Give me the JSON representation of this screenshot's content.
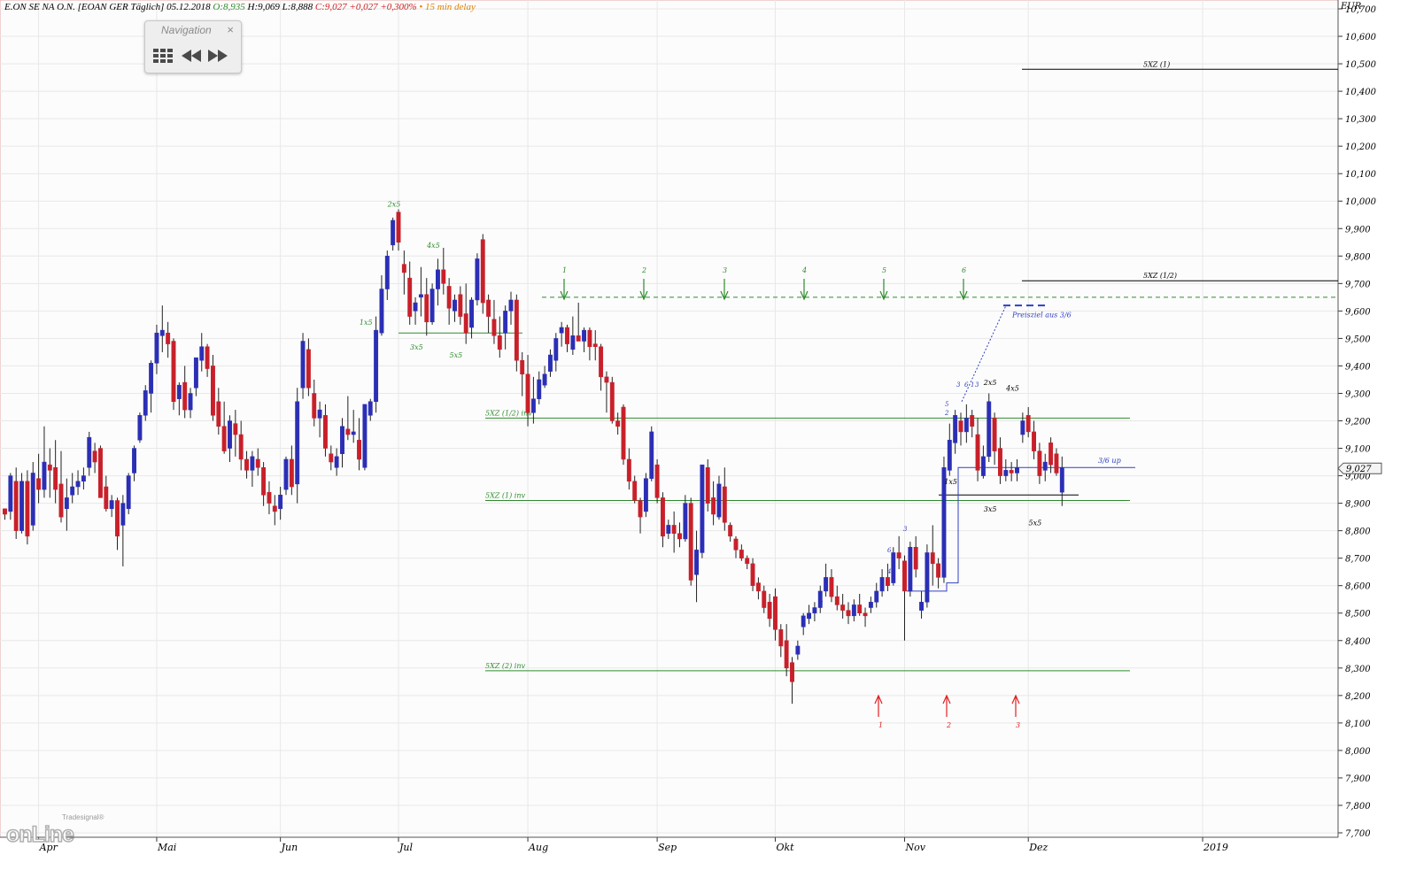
{
  "header": {
    "title": "E.ON SE NA O.N. [EOAN GER Täglich] 05.12.2018",
    "open": "O:8,935",
    "hl": "H:9,069 L:8,888",
    "close": "C:9,027 +0,027 +0,300%",
    "delay": "• 15 min delay"
  },
  "navigation": {
    "title": "Navigation",
    "close": "×"
  },
  "logo": {
    "brand": "Tradesignal®",
    "text": "onLine"
  },
  "colors": {
    "up": "#2b2fb5",
    "down": "#c8202a",
    "green": "#2e8b2e",
    "red": "#e02020",
    "blue": "#3040c0"
  },
  "chart_data": {
    "type": "candlestick",
    "currency": "EUR",
    "ylim": [
      7.7,
      10.7
    ],
    "y_ticks": [
      "7,700",
      "7,800",
      "7,900",
      "8,000",
      "8,100",
      "8,200",
      "8,300",
      "8,400",
      "8,500",
      "8,600",
      "8,700",
      "8,800",
      "8,900",
      "9,000",
      "9,100",
      "9,200",
      "9,300",
      "9,400",
      "9,500",
      "9,600",
      "9,700",
      "9,800",
      "9,900",
      "10,000",
      "10,100",
      "10,200",
      "10,300",
      "10,400",
      "10,500",
      "10,600",
      "10,700"
    ],
    "x_labels": [
      {
        "label": "Apr",
        "bar": 6
      },
      {
        "label": "Mai",
        "bar": 27
      },
      {
        "label": "Jun",
        "bar": 49
      },
      {
        "label": "Jul",
        "bar": 70
      },
      {
        "label": "Aug",
        "bar": 93
      },
      {
        "label": "Sep",
        "bar": 116
      },
      {
        "label": "Okt",
        "bar": 137
      },
      {
        "label": "Nov",
        "bar": 160
      },
      {
        "label": "Dez",
        "bar": 182
      },
      {
        "label": "2019",
        "bar": 213
      }
    ],
    "last_price_label": "9,027",
    "candles": [
      [
        8.88,
        8.88,
        8.84,
        8.86
      ],
      [
        8.87,
        9.01,
        8.84,
        9.0
      ],
      [
        8.98,
        9.03,
        8.77,
        8.8
      ],
      [
        8.8,
        9.01,
        8.79,
        8.98
      ],
      [
        8.98,
        9.02,
        8.75,
        8.78
      ],
      [
        8.82,
        9.05,
        8.8,
        9.01
      ],
      [
        8.99,
        9.08,
        8.9,
        8.95
      ],
      [
        8.95,
        9.18,
        8.92,
        9.05
      ],
      [
        9.04,
        9.1,
        8.92,
        9.02
      ],
      [
        9.03,
        9.13,
        8.9,
        8.95
      ],
      [
        8.97,
        9.09,
        8.83,
        8.85
      ],
      [
        8.88,
        8.99,
        8.8,
        8.92
      ],
      [
        8.93,
        9.01,
        8.9,
        8.96
      ],
      [
        8.96,
        9.02,
        8.93,
        8.98
      ],
      [
        8.98,
        9.03,
        8.95,
        9.0
      ],
      [
        9.03,
        9.16,
        9.0,
        9.14
      ],
      [
        9.09,
        9.12,
        9.01,
        9.05
      ],
      [
        9.1,
        9.11,
        8.92,
        8.92
      ],
      [
        8.96,
        9.0,
        8.87,
        8.88
      ],
      [
        8.88,
        8.93,
        8.85,
        8.91
      ],
      [
        8.91,
        8.92,
        8.73,
        8.78
      ],
      [
        8.82,
        8.93,
        8.67,
        8.9
      ],
      [
        8.88,
        9.01,
        8.86,
        9.0
      ],
      [
        9.01,
        9.11,
        8.98,
        9.1
      ],
      [
        9.13,
        9.23,
        9.12,
        9.22
      ],
      [
        9.22,
        9.33,
        9.2,
        9.31
      ],
      [
        9.3,
        9.42,
        9.23,
        9.41
      ],
      [
        9.41,
        9.55,
        9.37,
        9.52
      ],
      [
        9.51,
        9.62,
        9.45,
        9.53
      ],
      [
        9.52,
        9.56,
        9.43,
        9.48
      ],
      [
        9.49,
        9.5,
        9.24,
        9.27
      ],
      [
        9.28,
        9.34,
        9.22,
        9.33
      ],
      [
        9.34,
        9.4,
        9.21,
        9.24
      ],
      [
        9.24,
        9.32,
        9.21,
        9.3
      ],
      [
        9.32,
        9.43,
        9.29,
        9.43
      ],
      [
        9.42,
        9.52,
        9.38,
        9.47
      ],
      [
        9.47,
        9.48,
        9.36,
        9.39
      ],
      [
        9.4,
        9.44,
        9.2,
        9.22
      ],
      [
        9.27,
        9.32,
        9.15,
        9.18
      ],
      [
        9.18,
        9.27,
        9.08,
        9.09
      ],
      [
        9.1,
        9.22,
        9.05,
        9.2
      ],
      [
        9.19,
        9.24,
        9.07,
        9.15
      ],
      [
        9.15,
        9.2,
        9.02,
        9.06
      ],
      [
        9.06,
        9.09,
        8.99,
        9.02
      ],
      [
        9.02,
        9.09,
        8.96,
        9.07
      ],
      [
        9.06,
        9.1,
        9.0,
        9.03
      ],
      [
        9.03,
        9.05,
        8.89,
        8.93
      ],
      [
        8.94,
        8.98,
        8.86,
        8.9
      ],
      [
        8.89,
        8.93,
        8.82,
        8.87
      ],
      [
        8.88,
        8.96,
        8.84,
        8.93
      ],
      [
        8.95,
        9.07,
        8.93,
        9.06
      ],
      [
        9.06,
        9.11,
        8.93,
        8.96
      ],
      [
        8.97,
        9.32,
        8.9,
        9.27
      ],
      [
        9.32,
        9.52,
        9.28,
        9.49
      ],
      [
        9.46,
        9.5,
        9.29,
        9.32
      ],
      [
        9.3,
        9.35,
        9.18,
        9.21
      ],
      [
        9.21,
        9.27,
        9.14,
        9.24
      ],
      [
        9.22,
        9.26,
        9.07,
        9.1
      ],
      [
        9.08,
        9.11,
        9.02,
        9.05
      ],
      [
        9.03,
        9.1,
        9.0,
        9.07
      ],
      [
        9.08,
        9.21,
        9.03,
        9.18
      ],
      [
        9.17,
        9.29,
        9.13,
        9.15
      ],
      [
        9.15,
        9.24,
        9.12,
        9.16
      ],
      [
        9.13,
        9.21,
        9.02,
        9.06
      ],
      [
        9.03,
        9.26,
        9.02,
        9.26
      ],
      [
        9.22,
        9.28,
        9.2,
        9.27
      ],
      [
        9.27,
        9.58,
        9.23,
        9.53
      ],
      [
        9.52,
        9.73,
        9.51,
        9.68
      ],
      [
        9.68,
        9.82,
        9.64,
        9.8
      ],
      [
        9.84,
        9.94,
        9.82,
        9.93
      ],
      [
        9.96,
        9.97,
        9.82,
        9.85
      ],
      [
        9.77,
        9.82,
        9.66,
        9.74
      ],
      [
        9.72,
        9.78,
        9.55,
        9.58
      ],
      [
        9.6,
        9.65,
        9.55,
        9.63
      ],
      [
        9.65,
        9.76,
        9.58,
        9.66
      ],
      [
        9.66,
        9.72,
        9.51,
        9.56
      ],
      [
        9.56,
        9.7,
        9.55,
        9.68
      ],
      [
        9.68,
        9.79,
        9.62,
        9.75
      ],
      [
        9.75,
        9.83,
        9.66,
        9.7
      ],
      [
        9.69,
        9.72,
        9.55,
        9.61
      ],
      [
        9.6,
        9.66,
        9.56,
        9.64
      ],
      [
        9.66,
        9.69,
        9.55,
        9.58
      ],
      [
        9.59,
        9.7,
        9.48,
        9.52
      ],
      [
        9.54,
        9.65,
        9.5,
        9.64
      ],
      [
        9.64,
        9.81,
        9.62,
        9.79
      ],
      [
        9.86,
        9.88,
        9.59,
        9.63
      ],
      [
        9.64,
        9.66,
        9.52,
        9.58
      ],
      [
        9.57,
        9.64,
        9.48,
        9.51
      ],
      [
        9.51,
        9.58,
        9.43,
        9.46
      ],
      [
        9.52,
        9.62,
        9.46,
        9.6
      ],
      [
        9.6,
        9.67,
        9.55,
        9.64
      ],
      [
        9.64,
        9.66,
        9.38,
        9.42
      ],
      [
        9.42,
        9.45,
        9.29,
        9.37
      ],
      [
        9.37,
        9.44,
        9.18,
        9.23
      ],
      [
        9.23,
        9.36,
        9.19,
        9.28
      ],
      [
        9.28,
        9.38,
        9.26,
        9.35
      ],
      [
        9.33,
        9.4,
        9.32,
        9.37
      ],
      [
        9.38,
        9.46,
        9.36,
        9.44
      ],
      [
        9.42,
        9.52,
        9.38,
        9.5
      ],
      [
        9.52,
        9.56,
        9.47,
        9.54
      ],
      [
        9.54,
        9.55,
        9.45,
        9.48
      ],
      [
        9.46,
        9.58,
        9.44,
        9.51
      ],
      [
        9.51,
        9.63,
        9.49,
        9.49
      ],
      [
        9.49,
        9.54,
        9.45,
        9.53
      ],
      [
        9.53,
        9.54,
        9.42,
        9.47
      ],
      [
        9.48,
        9.53,
        9.42,
        9.47
      ],
      [
        9.47,
        9.48,
        9.31,
        9.36
      ],
      [
        9.36,
        9.38,
        9.23,
        9.34
      ],
      [
        9.34,
        9.36,
        9.19,
        9.2
      ],
      [
        9.2,
        9.23,
        9.15,
        9.18
      ],
      [
        9.25,
        9.26,
        9.04,
        9.06
      ],
      [
        9.06,
        9.1,
        8.95,
        8.98
      ],
      [
        8.98,
        9.0,
        8.9,
        8.91
      ],
      [
        8.91,
        8.92,
        8.79,
        8.85
      ],
      [
        8.87,
        9.01,
        8.85,
        8.99
      ],
      [
        8.99,
        9.18,
        8.98,
        9.16
      ],
      [
        9.04,
        9.06,
        8.9,
        8.92
      ],
      [
        8.92,
        8.94,
        8.74,
        8.78
      ],
      [
        8.79,
        8.84,
        8.77,
        8.82
      ],
      [
        8.82,
        8.87,
        8.72,
        8.79
      ],
      [
        8.79,
        8.83,
        8.74,
        8.77
      ],
      [
        8.77,
        8.93,
        8.76,
        8.9
      ],
      [
        8.9,
        8.92,
        8.6,
        8.62
      ],
      [
        8.64,
        8.8,
        8.54,
        8.73
      ],
      [
        8.72,
        9.01,
        8.7,
        9.04
      ],
      [
        9.03,
        9.06,
        8.87,
        8.9
      ],
      [
        8.92,
        8.98,
        8.82,
        8.86
      ],
      [
        8.85,
        9.0,
        8.84,
        8.97
      ],
      [
        8.96,
        9.03,
        8.8,
        8.83
      ],
      [
        8.82,
        8.83,
        8.76,
        8.78
      ],
      [
        8.77,
        8.78,
        8.7,
        8.73
      ],
      [
        8.73,
        8.75,
        8.69,
        8.7
      ],
      [
        8.7,
        8.71,
        8.66,
        8.68
      ],
      [
        8.68,
        8.7,
        8.58,
        8.6
      ],
      [
        8.61,
        8.63,
        8.55,
        8.58
      ],
      [
        8.58,
        8.6,
        8.5,
        8.52
      ],
      [
        8.54,
        8.57,
        8.45,
        8.48
      ],
      [
        8.56,
        8.59,
        8.4,
        8.44
      ],
      [
        8.44,
        8.46,
        8.34,
        8.38
      ],
      [
        8.4,
        8.46,
        8.27,
        8.3
      ],
      [
        8.32,
        8.34,
        8.17,
        8.25
      ],
      [
        8.35,
        8.4,
        8.33,
        8.38
      ],
      [
        8.45,
        8.5,
        8.42,
        8.49
      ],
      [
        8.48,
        8.53,
        8.46,
        8.5
      ],
      [
        8.5,
        8.54,
        8.47,
        8.52
      ],
      [
        8.52,
        8.6,
        8.5,
        8.58
      ],
      [
        8.58,
        8.68,
        8.56,
        8.63
      ],
      [
        8.63,
        8.66,
        8.54,
        8.56
      ],
      [
        8.56,
        8.6,
        8.51,
        8.53
      ],
      [
        8.53,
        8.57,
        8.48,
        8.51
      ],
      [
        8.51,
        8.54,
        8.46,
        8.49
      ],
      [
        8.49,
        8.55,
        8.47,
        8.53
      ],
      [
        8.53,
        8.57,
        8.49,
        8.5
      ],
      [
        8.5,
        8.52,
        8.45,
        8.49
      ],
      [
        8.52,
        8.56,
        8.5,
        8.54
      ],
      [
        8.54,
        8.61,
        8.52,
        8.58
      ],
      [
        8.58,
        8.66,
        8.56,
        8.63
      ],
      [
        8.63,
        8.68,
        8.58,
        8.6
      ],
      [
        8.61,
        8.74,
        8.6,
        8.72
      ],
      [
        8.72,
        8.78,
        8.66,
        8.7
      ],
      [
        8.69,
        8.71,
        8.4,
        8.58
      ],
      [
        8.58,
        8.76,
        8.56,
        8.74
      ],
      [
        8.74,
        8.78,
        8.63,
        8.66
      ],
      [
        8.51,
        8.58,
        8.48,
        8.54
      ],
      [
        8.54,
        8.75,
        8.52,
        8.72
      ],
      [
        8.72,
        8.82,
        8.6,
        8.68
      ],
      [
        8.68,
        8.7,
        8.59,
        8.63
      ],
      [
        8.63,
        9.07,
        8.61,
        9.03
      ],
      [
        9.02,
        9.19,
        9.0,
        9.13
      ],
      [
        9.12,
        9.24,
        9.08,
        9.22
      ],
      [
        9.2,
        9.23,
        9.11,
        9.16
      ],
      [
        9.16,
        9.26,
        9.12,
        9.21
      ],
      [
        9.22,
        9.24,
        9.14,
        9.18
      ],
      [
        9.15,
        9.21,
        8.98,
        9.02
      ],
      [
        9.0,
        9.11,
        8.99,
        9.07
      ],
      [
        9.07,
        9.3,
        9.05,
        9.27
      ],
      [
        9.21,
        9.23,
        9.04,
        9.09
      ],
      [
        9.1,
        9.14,
        8.97,
        9.0
      ],
      [
        9.0,
        9.06,
        8.98,
        9.02
      ],
      [
        9.02,
        9.05,
        8.98,
        9.01
      ],
      [
        9.01,
        9.06,
        8.98,
        9.03
      ],
      [
        9.15,
        9.23,
        9.12,
        9.2
      ],
      [
        9.22,
        9.25,
        9.14,
        9.16
      ],
      [
        9.16,
        9.2,
        9.06,
        9.09
      ],
      [
        9.09,
        9.12,
        8.97,
        9.0
      ],
      [
        9.02,
        9.08,
        8.98,
        9.05
      ],
      [
        9.12,
        9.14,
        9.01,
        9.04
      ],
      [
        9.08,
        9.1,
        9.0,
        9.01
      ],
      [
        8.94,
        9.07,
        8.89,
        9.03
      ]
    ],
    "horizontal_lines": [
      {
        "label": "5XZ (1)",
        "y": 10.48,
        "color": "#000000"
      },
      {
        "label": "5XZ (1/2)",
        "y": 9.71,
        "color": "#000000"
      },
      {
        "label": "5XZ (1/2) inv",
        "y": 9.21,
        "color": "#2e8b2e"
      },
      {
        "label": "5XZ (1) inv",
        "y": 8.91,
        "color": "#2e8b2e"
      },
      {
        "label": "5XZ (2) inv",
        "y": 8.29,
        "color": "#2e8b2e"
      },
      {
        "label": "",
        "y": 9.65,
        "color": "#2e8b2e",
        "dashed": true
      }
    ],
    "annotations": [
      {
        "text": "Preisziel aus 3/6",
        "y": 9.59,
        "color": "#3040c0"
      },
      {
        "text": "3/6 up",
        "y": 9.04,
        "color": "#3040c0"
      },
      {
        "text": "2x5",
        "bar": 69,
        "y": 9.98,
        "color": "#2e8b2e"
      },
      {
        "text": "4x5",
        "bar": 76,
        "y": 9.83,
        "color": "#2e8b2e"
      },
      {
        "text": "1x5",
        "bar": 64,
        "y": 9.55,
        "color": "#2e8b2e"
      },
      {
        "text": "3x5",
        "bar": 73,
        "y": 9.46,
        "color": "#2e8b2e"
      },
      {
        "text": "5x5",
        "bar": 80,
        "y": 9.43,
        "color": "#2e8b2e"
      },
      {
        "text": "2x5",
        "bar": 175,
        "y": 9.33,
        "color": "#000000"
      },
      {
        "text": "4x5",
        "bar": 179,
        "y": 9.31,
        "color": "#000000"
      },
      {
        "text": "1x5",
        "bar": 168,
        "y": 8.97,
        "color": "#000000"
      },
      {
        "text": "3x5",
        "bar": 175,
        "y": 8.87,
        "color": "#000000"
      },
      {
        "text": "5x5",
        "bar": 183,
        "y": 8.82,
        "color": "#000000"
      }
    ],
    "green_arrows": [
      "1",
      "2",
      "3",
      "4",
      "5",
      "6"
    ],
    "red_arrows": [
      "1",
      "2",
      "3"
    ],
    "blue_counts": [
      "3",
      "6",
      "3",
      "5",
      "2",
      "3",
      "4",
      "6",
      "1",
      "3"
    ]
  }
}
